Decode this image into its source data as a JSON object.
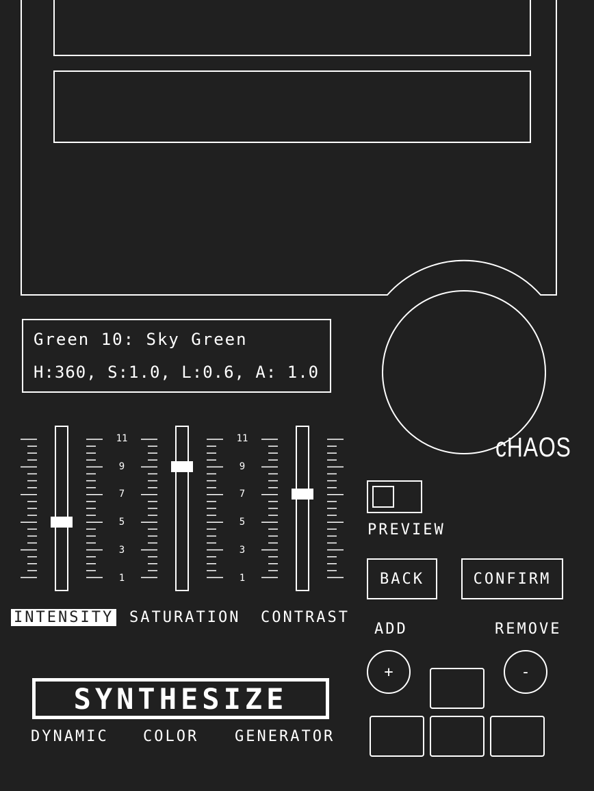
{
  "color_info": {
    "name": "Green 10: Sky Green",
    "values": "H:360, S:1.0, L:0.6, A: 1.0"
  },
  "sliders": [
    {
      "label": "INTENSITY",
      "level": 0.5,
      "active": true
    },
    {
      "label": "SATURATION",
      "level": 0.9,
      "active": false
    },
    {
      "label": "CONTRAST",
      "level": 0.7,
      "active": false
    }
  ],
  "scale_numbers": [
    "11",
    "9",
    "7",
    "5",
    "3",
    "1"
  ],
  "knob": {
    "label": "cHAOS"
  },
  "preview": {
    "label": "PREVIEW",
    "checked": false
  },
  "buttons": {
    "back": "BACK",
    "confirm": "CONFIRM"
  },
  "add": {
    "label": "ADD",
    "symbol": "+"
  },
  "remove": {
    "label": "REMOVE",
    "symbol": "-"
  },
  "brand": {
    "logo": "SYNTHESIZE",
    "tagline_1": "DYNAMIC",
    "tagline_2": "COLOR",
    "tagline_3": "GENERATOR"
  },
  "colors": {
    "background": "#202020",
    "foreground": "#ffffff"
  }
}
